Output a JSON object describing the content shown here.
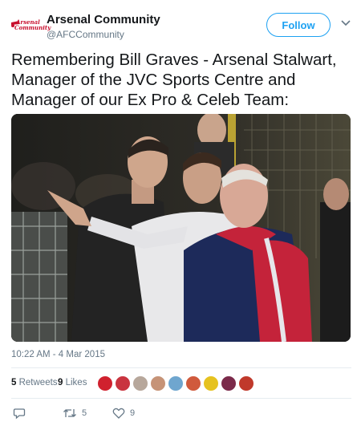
{
  "account": {
    "logo_text_line1": "Arsenal",
    "logo_text_line2": "Community",
    "name": "Arsenal Community",
    "handle": "@AFCCommunity",
    "follow_label": "Follow"
  },
  "tweet": {
    "text": "Remembering Bill Graves - Arsenal Stalwart, Manager of the JVC Sports Centre and Manager of our Ex Pro & Celeb Team:",
    "timestamp": "10:22 AM - 4 Mar 2015"
  },
  "stats": {
    "retweets_count": "5",
    "retweets_label": "Retweets",
    "likes_count": "9",
    "likes_label": "Likes"
  },
  "actions": {
    "retweet_count": "5",
    "like_count": "9"
  },
  "colors": {
    "accent": "#1da1f2",
    "brand": "#c8102e",
    "muted": "#657786"
  },
  "icons": [
    "reply-icon",
    "retweet-icon",
    "heart-icon",
    "chevron-down-icon"
  ]
}
